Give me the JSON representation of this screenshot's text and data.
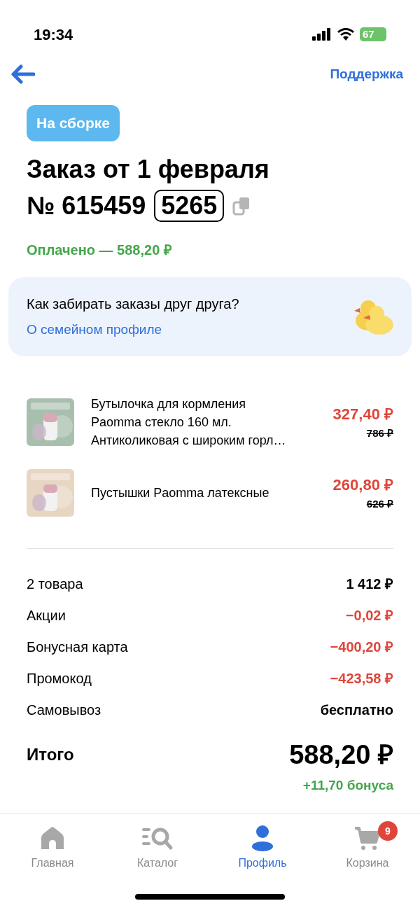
{
  "status_bar": {
    "time": "19:34",
    "battery": "67"
  },
  "nav": {
    "support": "Поддержка"
  },
  "order": {
    "status": "На сборке",
    "title": "Заказ от 1 февраля",
    "number_prefix": "№ 615459",
    "code": "5265",
    "paid": "Оплачено — 588,20 ₽"
  },
  "family_card": {
    "question": "Как забирать заказы друг друга?",
    "link": "О семейном профиле"
  },
  "products": [
    {
      "name": "Бутылочка для кормления Paomma стекло 160 мл. Антиколиковая с широким горл…",
      "price": "327,40 ₽",
      "old_price": "786 ₽"
    },
    {
      "name": "Пустышки Paomma латексные",
      "price": "260,80 ₽",
      "old_price": "626 ₽"
    }
  ],
  "summary": [
    {
      "label": "2 товара",
      "value": "1 412 ₽",
      "kind": "plain"
    },
    {
      "label": "Акции",
      "value": "−0,02 ₽",
      "kind": "discount"
    },
    {
      "label": "Бонусная карта",
      "value": "−400,20 ₽",
      "kind": "discount"
    },
    {
      "label": "Промокод",
      "value": "−423,58 ₽",
      "kind": "discount"
    },
    {
      "label": "Самовывоз",
      "value": "бесплатно",
      "kind": "plain"
    }
  ],
  "total": {
    "label": "Итого",
    "value": "588,20 ₽",
    "bonus": "+11,70 бонуса"
  },
  "tab_bar": [
    {
      "label": "Главная",
      "kind": "home",
      "selected": false
    },
    {
      "label": "Каталог",
      "kind": "catalog",
      "selected": false
    },
    {
      "label": "Профиль",
      "kind": "profile",
      "selected": true
    },
    {
      "label": "Корзина",
      "kind": "cart",
      "selected": false,
      "badge": "9"
    }
  ]
}
